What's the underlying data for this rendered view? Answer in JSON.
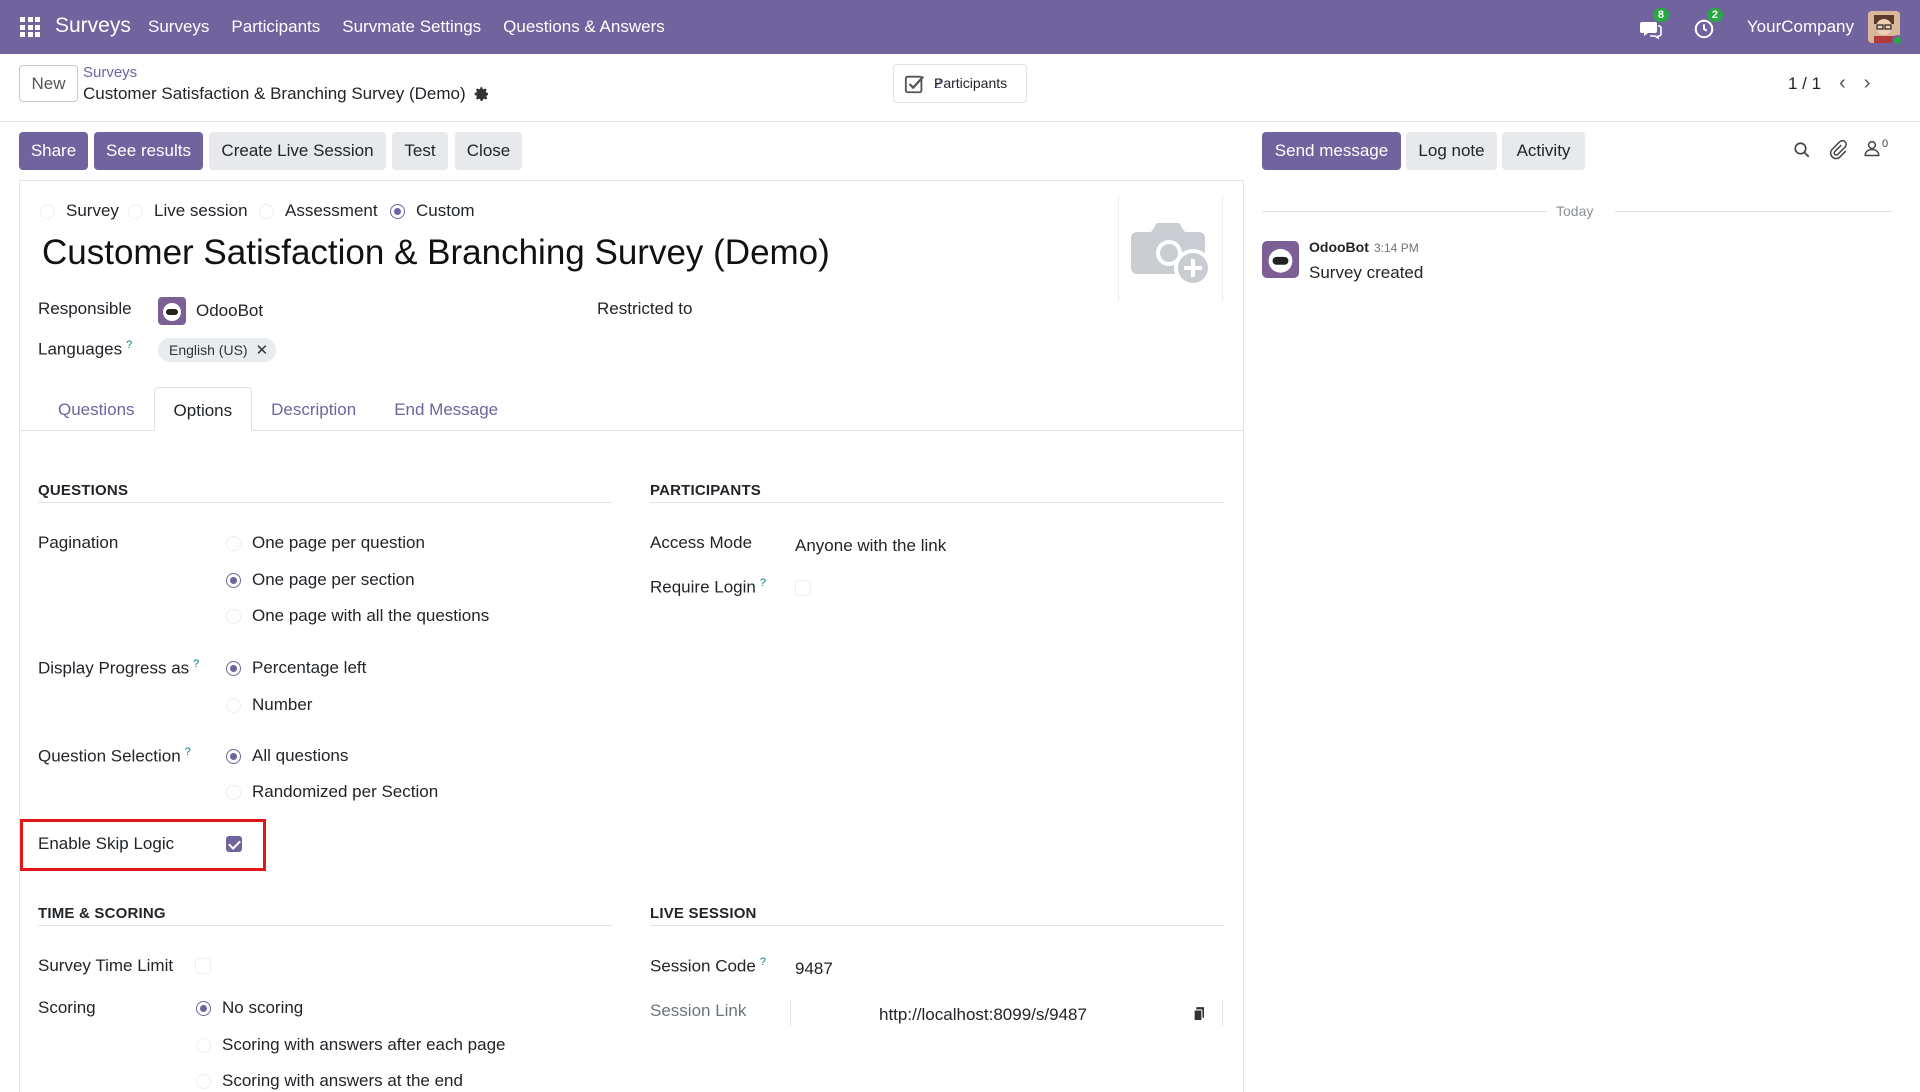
{
  "navbar": {
    "brand": "Surveys",
    "menu": [
      "Surveys",
      "Participants",
      "Survmate Settings",
      "Questions & Answers"
    ],
    "messages_badge": "8",
    "activities_badge": "2",
    "company": "YourCompany"
  },
  "control_panel": {
    "new_label": "New",
    "breadcrumb_parent": "Surveys",
    "breadcrumb_current": "Customer Satisfaction & Branching Survey (Demo)",
    "participants_label": "Participants",
    "participants_count": "2",
    "pager": "1 / 1"
  },
  "actions": {
    "share": "Share",
    "see_results": "See results",
    "create_live_session": "Create Live Session",
    "test": "Test",
    "close": "Close"
  },
  "survey_type": {
    "options": [
      "Survey",
      "Live session",
      "Assessment",
      "Custom"
    ],
    "selected": "Custom"
  },
  "form": {
    "title": "Customer Satisfaction & Branching Survey (Demo)",
    "responsible_label": "Responsible",
    "responsible_value": "OdooBot",
    "restricted_label": "Restricted to",
    "languages_label": "Languages",
    "language_tag": "English (US)"
  },
  "tabs": [
    "Questions",
    "Options",
    "Description",
    "End Message"
  ],
  "active_tab": "Options",
  "questions_section": {
    "title": "QUESTIONS",
    "pagination_label": "Pagination",
    "pagination_options": [
      "One page per question",
      "One page per section",
      "One page with all the questions"
    ],
    "pagination_selected": "One page per section",
    "progress_label": "Display Progress as",
    "progress_options": [
      "Percentage left",
      "Number"
    ],
    "progress_selected": "Percentage left",
    "selection_label": "Question Selection",
    "selection_options": [
      "All questions",
      "Randomized per Section"
    ],
    "selection_selected": "All questions",
    "skip_logic_label": "Enable Skip Logic",
    "skip_logic_checked": true
  },
  "participants_section": {
    "title": "PARTICIPANTS",
    "access_mode_label": "Access Mode",
    "access_mode_value": "Anyone with the link",
    "require_login_label": "Require Login",
    "require_login_checked": false
  },
  "time_section": {
    "title": "TIME & SCORING",
    "time_limit_label": "Survey Time Limit",
    "time_limit_checked": false,
    "scoring_label": "Scoring",
    "scoring_options": [
      "No scoring",
      "Scoring with answers after each page",
      "Scoring with answers at the end"
    ],
    "scoring_selected": "No scoring"
  },
  "live_section": {
    "title": "LIVE SESSION",
    "session_code_label": "Session Code",
    "session_code_value": "9487",
    "session_link_label": "Session Link",
    "session_link_value": "http://localhost:8099/s/9487"
  },
  "chatter": {
    "send_message": "Send message",
    "log_note": "Log note",
    "activity": "Activity",
    "followers_count": "0",
    "date_separator": "Today",
    "message_author": "OdooBot",
    "message_time": "3:14 PM",
    "message_body": "Survey created"
  },
  "colors": {
    "brand": "#71639e",
    "badge": "#28a745",
    "highlight": "#e0161b"
  }
}
